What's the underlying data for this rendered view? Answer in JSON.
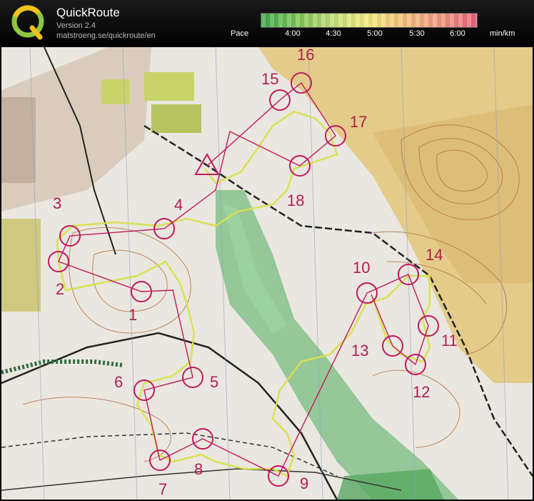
{
  "app": {
    "title": "QuickRoute",
    "version": "Version 2.4",
    "url": "matstroeng.se/quickroute/en"
  },
  "pace_scale": {
    "label": "Pace",
    "ticks": [
      "4:00",
      "4:30",
      "5:00",
      "5:30",
      "6:00"
    ],
    "unit": "min/km",
    "colors": [
      "#3fa84a",
      "#c9e27a",
      "#f1ec7d",
      "#f4c27a",
      "#e8647a"
    ]
  },
  "map": {
    "control_numbers": [
      "1",
      "2",
      "3",
      "4",
      "5",
      "6",
      "7",
      "8",
      "9",
      "10",
      "11",
      "12",
      "13",
      "14",
      "15",
      "16",
      "17",
      "18"
    ],
    "course_color": "#c2185b",
    "route_color": "#d9e04a"
  }
}
